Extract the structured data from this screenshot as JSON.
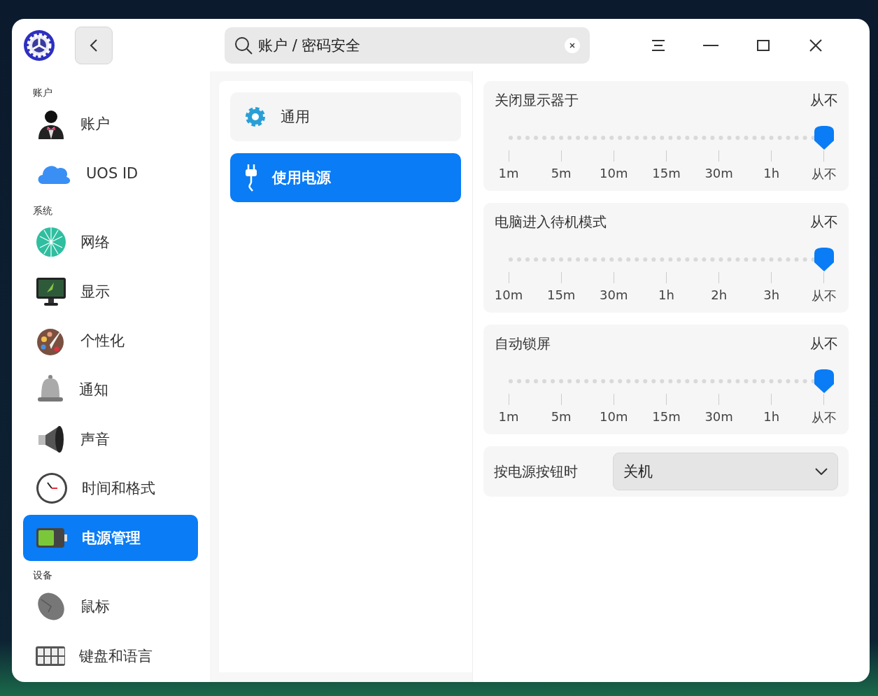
{
  "search": {
    "value": "账户 / 密码安全"
  },
  "sidebar": {
    "sections": [
      {
        "title": "账户",
        "items": [
          {
            "label": "账户",
            "selected": false
          },
          {
            "label": "UOS ID",
            "selected": false
          }
        ]
      },
      {
        "title": "系统",
        "items": [
          {
            "label": "网络",
            "selected": false
          },
          {
            "label": "显示",
            "selected": false
          },
          {
            "label": "个性化",
            "selected": false
          },
          {
            "label": "通知",
            "selected": false
          },
          {
            "label": "声音",
            "selected": false
          },
          {
            "label": "时间和格式",
            "selected": false
          },
          {
            "label": "电源管理",
            "selected": true
          }
        ]
      },
      {
        "title": "设备",
        "items": [
          {
            "label": "鼠标",
            "selected": false
          },
          {
            "label": "键盘和语言",
            "selected": false
          }
        ]
      }
    ]
  },
  "subnav": [
    {
      "label": "通用",
      "selected": false
    },
    {
      "label": "使用电源",
      "selected": true
    }
  ],
  "sliders": [
    {
      "title": "关闭显示器于",
      "value": "从不",
      "level": 1,
      "ticks": [
        "1m",
        "5m",
        "10m",
        "15m",
        "30m",
        "1h",
        "从不"
      ]
    },
    {
      "title": "电脑进入待机模式",
      "value": "从不",
      "level": 1,
      "ticks": [
        "10m",
        "15m",
        "30m",
        "1h",
        "2h",
        "3h",
        "从不"
      ]
    },
    {
      "title": "自动锁屏",
      "value": "从不",
      "level": 1,
      "ticks": [
        "1m",
        "5m",
        "10m",
        "15m",
        "30m",
        "1h",
        "从不"
      ]
    }
  ],
  "power_button": {
    "label": "按电源按钮时",
    "value": "关机"
  }
}
